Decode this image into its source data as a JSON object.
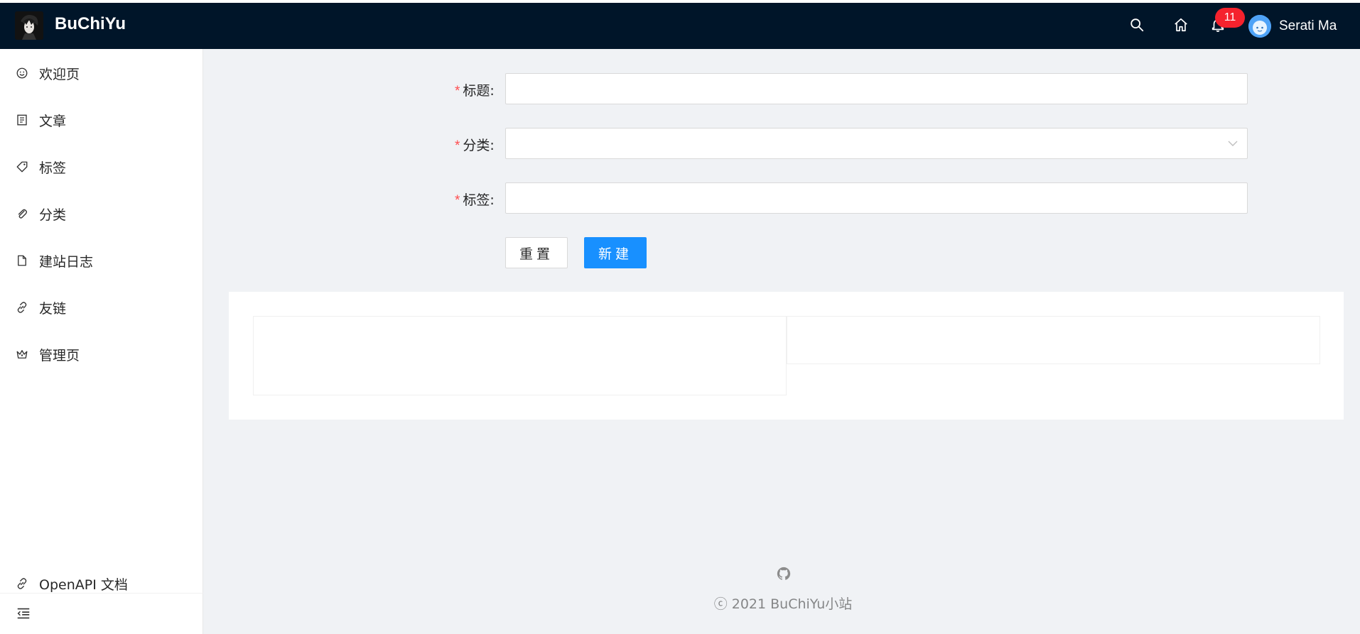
{
  "header": {
    "brand": "BuChiYu",
    "notification_count": "11",
    "username": "Serati Ma",
    "icons": [
      "search-icon",
      "home-icon",
      "bell-icon"
    ],
    "background": "#001529"
  },
  "sidebar": {
    "items": [
      {
        "label": "欢迎页",
        "icon": "smile-icon"
      },
      {
        "label": "文章",
        "icon": "article-icon"
      },
      {
        "label": "标签",
        "icon": "tag-icon"
      },
      {
        "label": "分类",
        "icon": "paperclip-icon"
      },
      {
        "label": "建站日志",
        "icon": "file-icon"
      },
      {
        "label": "友链",
        "icon": "link-icon"
      },
      {
        "label": "管理页",
        "icon": "crown-icon"
      }
    ],
    "bottom_link": {
      "label": "OpenAPI 文档",
      "icon": "link-icon"
    }
  },
  "form": {
    "title_label": "标题",
    "category_label": "分类",
    "tags_label": "标签",
    "required_mark": "*",
    "colon": ":",
    "title_value": "",
    "category_value": "",
    "tags_value": "",
    "reset_label": "重置",
    "create_label": "新建"
  },
  "footer": {
    "copyright": "ⓒ 2021 BuChiYu小站"
  },
  "colors": {
    "primary": "#1890ff",
    "required": "#ff4d4f",
    "badge": "#f5222d"
  }
}
